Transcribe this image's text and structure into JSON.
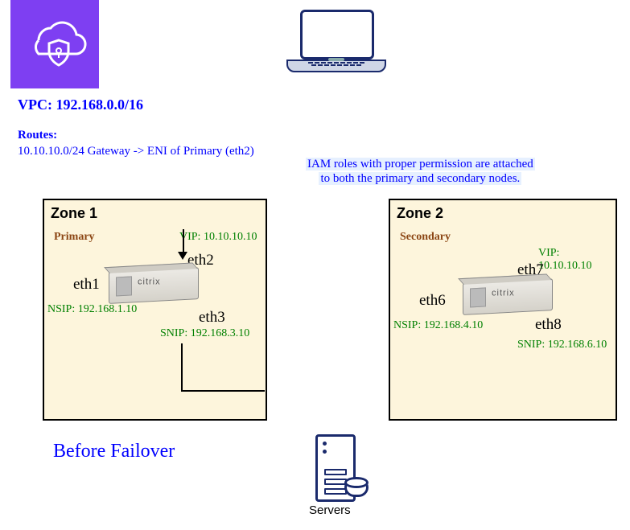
{
  "vpc_label": "VPC: 192.168.0.0/16",
  "routes_heading": "Routes:",
  "route1": "10.10.10.0/24 Gateway -> ENI of Primary (eth2)",
  "iam_line1": "IAM roles with proper permission are attached",
  "iam_line2": "to both the primary and secondary nodes.",
  "before_failover": "Before Failover",
  "servers_label": "Servers",
  "zone1": {
    "title": "Zone 1",
    "role": "Primary",
    "vip": "VIP: 10.10.10.10",
    "nsip": "NSIP: 192.168.1.10",
    "snip": "SNIP: 192.168.3.10",
    "if_mgmt": "eth1",
    "if_vip": "eth2",
    "if_snip": "eth3"
  },
  "zone2": {
    "title": "Zone 2",
    "role": "Secondary",
    "vip": "VIP: 10.10.10.10",
    "nsip": "NSIP: 192.168.4.10",
    "snip": "SNIP: 192.168.6.10",
    "if_mgmt": "eth6",
    "if_vip": "eth7",
    "if_snip": "eth8"
  },
  "icons": {
    "shield": "cloud-shield-icon",
    "laptop": "laptop-icon",
    "appliance": "citrix-appliance-icon",
    "server": "server-tower-icon"
  }
}
